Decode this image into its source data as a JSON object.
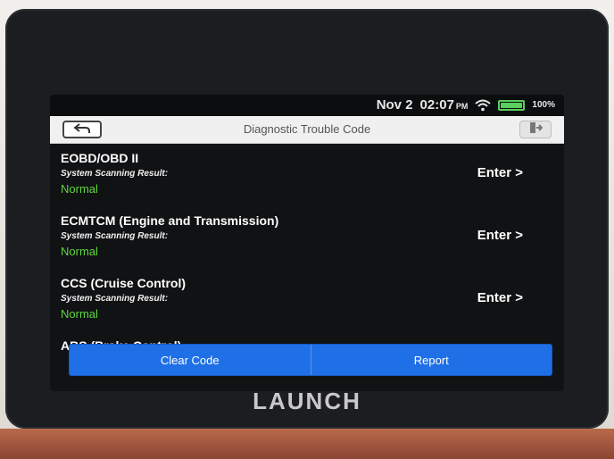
{
  "status": {
    "date": "Nov 2",
    "time": "02:07",
    "ampm": "PM",
    "battery_percent": "100%",
    "battery_level": 1.0,
    "icons": [
      "wifi-icon",
      "battery-icon"
    ]
  },
  "header": {
    "title": "Diagnostic Trouble Code",
    "back_icon": "back-arrow-icon",
    "exit_icon": "exit-icon"
  },
  "items": [
    {
      "name": "EOBD/OBD II",
      "label": "System Scanning Result:",
      "result": "Normal",
      "enter": "Enter >"
    },
    {
      "name": "ECMTCM (Engine and Transmission)",
      "label": "System Scanning Result:",
      "result": "Normal",
      "enter": "Enter >"
    },
    {
      "name": "CCS (Cruise Control)",
      "label": "System Scanning Result:",
      "result": "Normal",
      "enter": "Enter >"
    },
    {
      "name": "ABS (Brake Control)"
    }
  ],
  "bottom": {
    "clear_code": "Clear Code",
    "report": "Report"
  },
  "device": {
    "brand": "LAUNCH"
  },
  "colors": {
    "accent": "#1f6fe7",
    "normal": "#5dd63f",
    "battery": "#58d05e"
  }
}
